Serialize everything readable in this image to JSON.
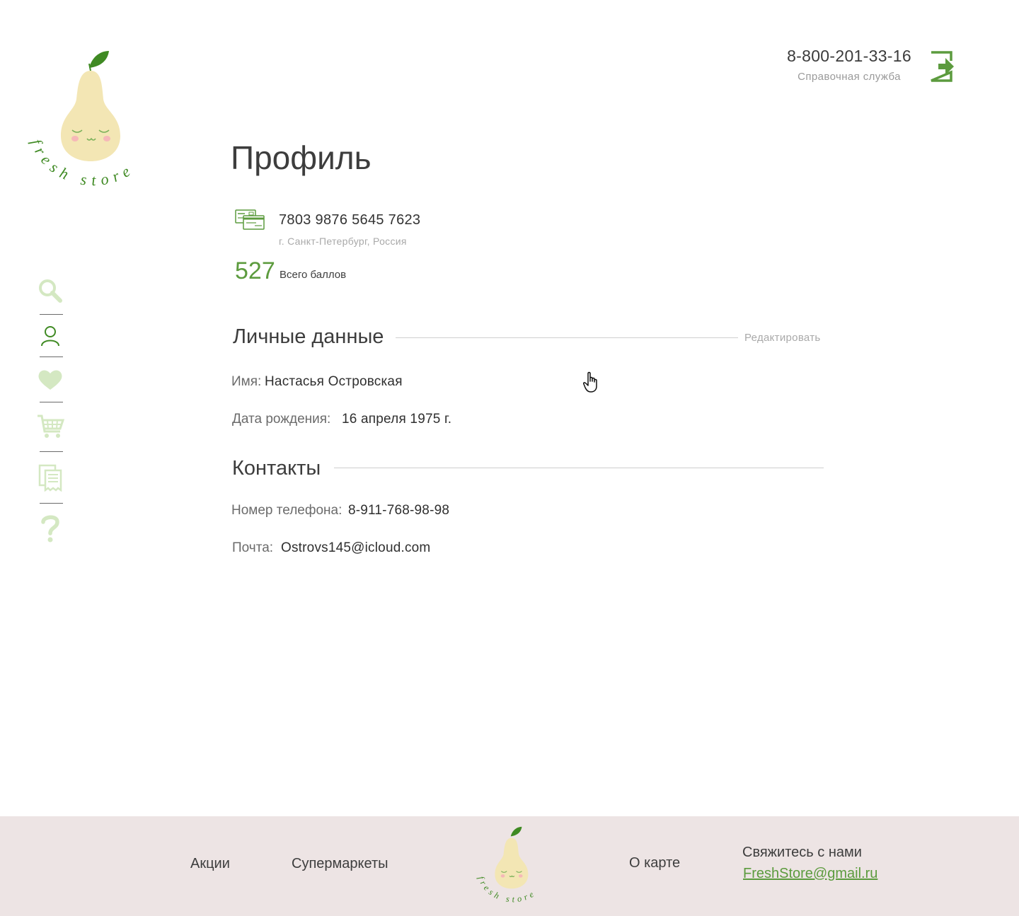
{
  "brand": {
    "logo_text": "fresh store"
  },
  "header": {
    "phone": "8-800-201-33-16",
    "phone_caption": "Справочная служба",
    "exit_icon": "logout-icon"
  },
  "sidebar": {
    "items": [
      {
        "icon": "search-icon"
      },
      {
        "icon": "profile-icon"
      },
      {
        "icon": "heart-icon"
      },
      {
        "icon": "cart-icon"
      },
      {
        "icon": "receipts-icon"
      },
      {
        "icon": "help-icon"
      }
    ]
  },
  "profile": {
    "title": "Профиль",
    "card_number": "7803 9876 5645 7623",
    "card_city": "г. Санкт-Петербург, Россия",
    "points": "527",
    "points_label": "Всего баллов"
  },
  "personal": {
    "title": "Личные данные",
    "edit_label": "Редактировать",
    "name_label": "Имя:",
    "name_value": "Настасья Островская",
    "birth_label": "Дата рождения:",
    "birth_value": "16 апреля 1975 г."
  },
  "contacts": {
    "title": "Контакты",
    "phone_label": "Номер телефона:",
    "phone_value": "8-911-768-98-98",
    "mail_label": "Почта:",
    "mail_value": "Ostrovs145@icloud.com"
  },
  "footer": {
    "promo": "Акции",
    "stores": "Супермаркеты",
    "about_card": "О карте",
    "contact_title": "Свяжитесь с нами",
    "contact_email": "FreshStore@gmail.ru"
  },
  "colors": {
    "accent": "#5c9b3e",
    "sidebar_icon": "#d4e8c2",
    "pear": "#f3e6b4",
    "footer_bg": "#ede4e4"
  }
}
